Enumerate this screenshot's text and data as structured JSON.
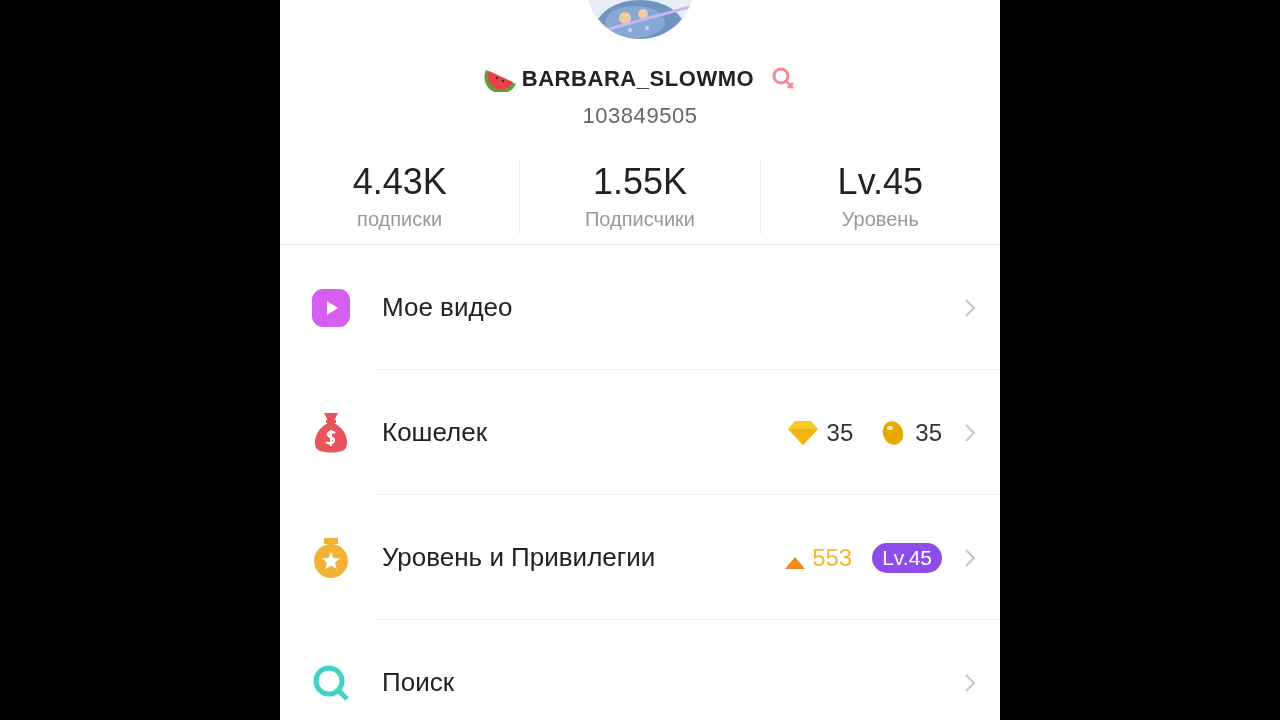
{
  "profile": {
    "username": "BARBARA_SLOWMO",
    "user_id": "103849505"
  },
  "stats": [
    {
      "value": "4.43K",
      "label": "подписки"
    },
    {
      "value": "1.55K",
      "label": "Подписчики"
    },
    {
      "value": "Lv.45",
      "label": "Уровень"
    }
  ],
  "menu": [
    {
      "kind": "video",
      "label": "Мое видео"
    },
    {
      "kind": "wallet",
      "label": "Кошелек",
      "diamonds": "35",
      "coins": "35"
    },
    {
      "kind": "level",
      "label": "Уровень и Привилегии",
      "points": "553",
      "level_badge": "Lv.45"
    },
    {
      "kind": "search",
      "label": "Поиск"
    }
  ]
}
